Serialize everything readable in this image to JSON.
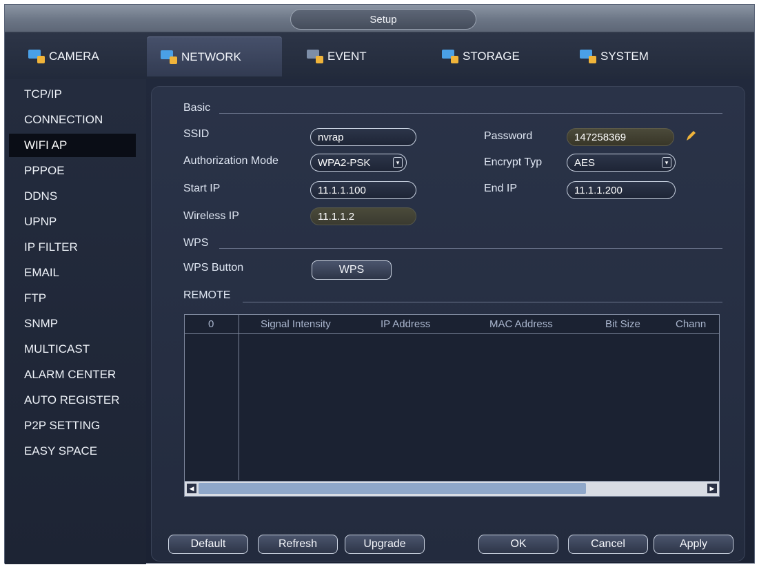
{
  "window": {
    "title": "Setup"
  },
  "tabs": [
    {
      "label": "CAMERA",
      "icon": "camera-icon",
      "color": "#4aa0e6",
      "active": false
    },
    {
      "label": "NETWORK",
      "icon": "network-icon",
      "color": "#4aa0e6",
      "active": true
    },
    {
      "label": "EVENT",
      "icon": "event-icon",
      "color": "#7d8ea8",
      "active": false
    },
    {
      "label": "STORAGE",
      "icon": "storage-icon",
      "color": "#4aa0e6",
      "active": false
    },
    {
      "label": "SYSTEM",
      "icon": "system-icon",
      "color": "#4aa0e6",
      "active": false
    }
  ],
  "sidebar": {
    "items": [
      {
        "label": "TCP/IP"
      },
      {
        "label": "CONNECTION"
      },
      {
        "label": "WIFI AP",
        "active": true
      },
      {
        "label": "PPPOE"
      },
      {
        "label": "DDNS"
      },
      {
        "label": "UPNP"
      },
      {
        "label": "IP FILTER"
      },
      {
        "label": "EMAIL"
      },
      {
        "label": "FTP"
      },
      {
        "label": "SNMP"
      },
      {
        "label": "MULTICAST"
      },
      {
        "label": "ALARM CENTER"
      },
      {
        "label": "AUTO REGISTER"
      },
      {
        "label": "P2P SETTING"
      },
      {
        "label": "EASY SPACE"
      }
    ]
  },
  "basic": {
    "section": "Basic",
    "ssid_label": "SSID",
    "ssid_value": "nvrap",
    "password_label": "Password",
    "password_value": "147258369",
    "auth_label": "Authorization Mode",
    "auth_value": "WPA2-PSK",
    "encrypt_label": "Encrypt Typ",
    "encrypt_value": "AES",
    "start_ip_label": "Start IP",
    "start_ip_value": "11.1.1.100",
    "end_ip_label": "End IP",
    "end_ip_value": "11.1.1.200",
    "wireless_ip_label": "Wireless IP",
    "wireless_ip_value": "11.1.1.2"
  },
  "wps": {
    "section": "WPS",
    "button_label": "WPS Button",
    "button_text": "WPS"
  },
  "remote": {
    "section": "REMOTE",
    "columns": [
      "0",
      "Signal Intensity",
      "IP Address",
      "MAC Address",
      "Bit Size",
      "Chann"
    ],
    "rows": []
  },
  "buttons": {
    "default": "Default",
    "refresh": "Refresh",
    "upgrade": "Upgrade",
    "ok": "OK",
    "cancel": "Cancel",
    "apply": "Apply"
  },
  "colors": {
    "background": "#1b2233",
    "accent": "#4aa0e6",
    "edit_icon": "#f0b43a"
  }
}
